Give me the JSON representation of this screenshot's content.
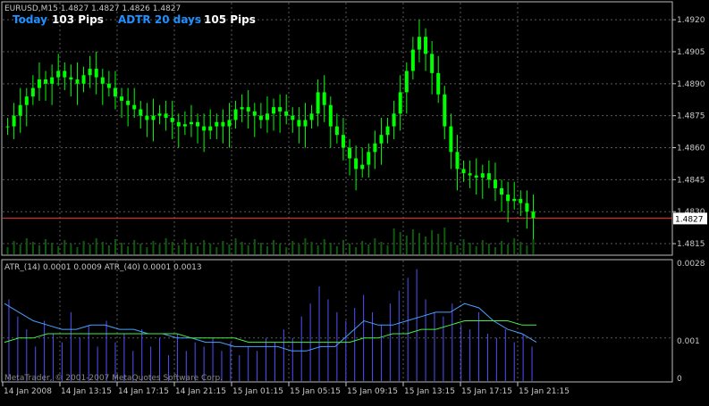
{
  "window": {
    "symbol_header": "EURUSD,M15  1.4827 1.4827 1.4826 1.4827",
    "today_label": "Today",
    "today_value": "103 Pips",
    "adtr_label": "ADTR 20 days",
    "adtr_value": "105 Pips",
    "indicator_header": "ATR_(14) 0.0001 0.0009  ATR_(40) 0.0001 0.0013",
    "copyright": "MetaTrader, © 2001-2007 MetaQuotes Software Corp."
  },
  "colors": {
    "background": "#000000",
    "grid": "#5a5a5a",
    "candle": "#00ff00",
    "volume": "#0f5a0f",
    "current_price_line": "#ff3030",
    "label_cyan": "#1e90ff",
    "label_white": "#ffffff",
    "atr_hist": "#5050ff",
    "atr14_line": "#4aa0ff",
    "atr40_line": "#44ee44",
    "axis_text": "#c8c8c8"
  },
  "chart_data": [
    {
      "type": "candlestick",
      "symbol": "EURUSD",
      "timeframe": "M15",
      "ylim": [
        1.481,
        1.4928
      ],
      "yticks": [
        "1.4920",
        "1.4905",
        "1.4890",
        "1.4875",
        "1.4860",
        "1.4845",
        "1.4830",
        "1.4815"
      ],
      "ytick_values": [
        1.492,
        1.4905,
        1.489,
        1.4875,
        1.486,
        1.4845,
        1.483,
        1.4815
      ],
      "current_price": 1.4827,
      "current_price_label": "1.4827",
      "grid": true,
      "series_close": [
        1.487,
        1.4875,
        1.488,
        1.4884,
        1.4888,
        1.4892,
        1.489,
        1.4893,
        1.4896,
        1.4893,
        1.4892,
        1.489,
        1.4894,
        1.4897,
        1.4893,
        1.489,
        1.4888,
        1.4884,
        1.4882,
        1.488,
        1.4878,
        1.4875,
        1.4873,
        1.4875,
        1.4876,
        1.4874,
        1.4872,
        1.487,
        1.4871,
        1.4872,
        1.487,
        1.4868,
        1.487,
        1.4872,
        1.487,
        1.4873,
        1.4878,
        1.4879,
        1.4877,
        1.4875,
        1.4873,
        1.4876,
        1.4879,
        1.4877,
        1.4875,
        1.4873,
        1.487,
        1.4873,
        1.4876,
        1.4886,
        1.488,
        1.487,
        1.4866,
        1.486,
        1.4855,
        1.485,
        1.4852,
        1.4858,
        1.4862,
        1.4866,
        1.487,
        1.4876,
        1.4886,
        1.4896,
        1.4906,
        1.4912,
        1.4904,
        1.4895,
        1.4885,
        1.487,
        1.4858,
        1.485,
        1.4848,
        1.4847,
        1.4846,
        1.4848,
        1.4845,
        1.4841,
        1.4838,
        1.4835,
        1.4836,
        1.4834,
        1.483,
        1.4827
      ]
    },
    {
      "type": "line",
      "name": "ATR",
      "ylim": [
        0.0,
        0.0028
      ],
      "yticks": [
        "0.0028",
        "0.001",
        "0"
      ],
      "ytick_values": [
        0.0028,
        0.001,
        0.0
      ],
      "series": [
        {
          "name": "ATR_(14)",
          "values": [
            0.0018,
            0.0016,
            0.0014,
            0.0013,
            0.0012,
            0.0012,
            0.0013,
            0.0013,
            0.0012,
            0.0012,
            0.0011,
            0.0011,
            0.001,
            0.001,
            0.0009,
            0.0009,
            0.0008,
            0.0008,
            0.0008,
            0.0008,
            0.0007,
            0.0007,
            0.0008,
            0.0008,
            0.0011,
            0.0014,
            0.0013,
            0.0013,
            0.0014,
            0.0015,
            0.0016,
            0.0016,
            0.0018,
            0.0017,
            0.0014,
            0.0012,
            0.0011,
            0.0009
          ]
        },
        {
          "name": "ATR_(40)",
          "values": [
            0.0009,
            0.001,
            0.001,
            0.0011,
            0.0011,
            0.0011,
            0.0011,
            0.0011,
            0.0011,
            0.0011,
            0.0011,
            0.0011,
            0.0011,
            0.001,
            0.001,
            0.001,
            0.001,
            0.0009,
            0.0009,
            0.0009,
            0.0009,
            0.0009,
            0.0009,
            0.0009,
            0.0009,
            0.001,
            0.001,
            0.0011,
            0.0011,
            0.0012,
            0.0012,
            0.0013,
            0.0014,
            0.0014,
            0.0014,
            0.0014,
            0.0013,
            0.0013
          ]
        }
      ],
      "histogram": [
        0.0019,
        0.0015,
        0.0012,
        0.0008,
        0.0014,
        0.0011,
        0.0009,
        0.0016,
        0.001,
        0.0013,
        0.0008,
        0.0014,
        0.0009,
        0.0011,
        0.0007,
        0.0012,
        0.0008,
        0.001,
        0.0006,
        0.0011,
        0.0007,
        0.0009,
        0.0008,
        0.001,
        0.0007,
        0.0009,
        0.0006,
        0.0008,
        0.0007,
        0.001,
        0.0009,
        0.0012,
        0.001,
        0.0015,
        0.0018,
        0.0022,
        0.0019,
        0.0016,
        0.0014,
        0.0017,
        0.002,
        0.0016,
        0.0013,
        0.0018,
        0.0021,
        0.0024,
        0.0026,
        0.0019,
        0.0016,
        0.0015,
        0.0018,
        0.0013,
        0.0012,
        0.0016,
        0.0011,
        0.001,
        0.0012,
        0.0009,
        0.0011,
        0.0008
      ]
    }
  ],
  "x_axis": {
    "ticks": [
      "14 Jan 2008",
      "14 Jan 13:15",
      "14 Jan 17:15",
      "14 Jan 21:15",
      "15 Jan 01:15",
      "15 Jan 05:15",
      "15 Jan 09:15",
      "15 Jan 13:15",
      "15 Jan 17:15",
      "15 Jan 21:15"
    ]
  }
}
